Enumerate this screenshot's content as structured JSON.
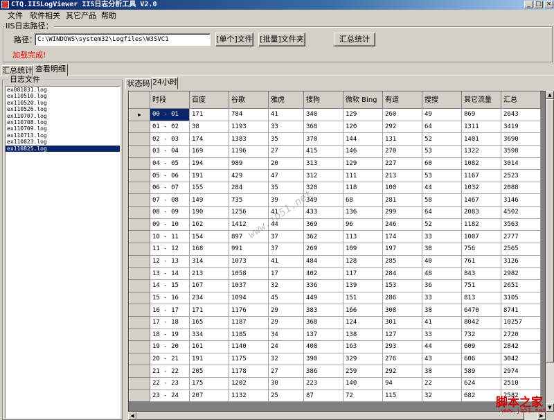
{
  "window": {
    "title": "CTQ.IISLogViewer IIS日志分析工具 V2.0",
    "minimize": "_",
    "maximize": "□",
    "close": "×"
  },
  "menu": [
    "文件",
    "软件相关",
    "其它产品",
    "帮助"
  ],
  "path_group": {
    "label": "IIS日志路径：",
    "path_label": "路径：",
    "path_value": "C:\\WINDOWS\\system32\\Logfiles\\W3SVC1",
    "single_button": "[单个]文件",
    "batch_button": "[批量]文件夹",
    "summary_button": "汇总统计",
    "status": "加载完成!"
  },
  "main_tabs": [
    "汇总统计",
    "查看明细"
  ],
  "log_files": {
    "label": "日志文件",
    "items": [
      "ex081031.log",
      "ex110510.log",
      "ex110520.log",
      "ex110526.log",
      "ex110707.log",
      "ex110708.log",
      "ex110709.log",
      "ex110713.log",
      "ex110823.log",
      "ex110825.log"
    ],
    "selected_index": 9
  },
  "sub_tabs": [
    "状态码",
    "24小时"
  ],
  "table": {
    "columns": [
      "时段",
      "百度",
      "谷歌",
      "雅虎",
      "搜狗",
      "微软 Bing",
      "有道",
      "搜搜",
      "其它流量",
      "汇总"
    ],
    "rows": [
      [
        "00 - 01",
        "171",
        "784",
        "41",
        "340",
        "129",
        "260",
        "49",
        "869",
        "2643"
      ],
      [
        "01 - 02",
        "38",
        "1193",
        "33",
        "368",
        "120",
        "292",
        "64",
        "1311",
        "3419"
      ],
      [
        "02 - 03",
        "174",
        "1383",
        "35",
        "370",
        "144",
        "131",
        "52",
        "1401",
        "3690"
      ],
      [
        "03 - 04",
        "169",
        "1196",
        "27",
        "415",
        "146",
        "270",
        "53",
        "1322",
        "3598"
      ],
      [
        "04 - 05",
        "194",
        "989",
        "20",
        "313",
        "129",
        "227",
        "60",
        "1082",
        "3014"
      ],
      [
        "05 - 06",
        "191",
        "429",
        "47",
        "312",
        "111",
        "213",
        "53",
        "1167",
        "2523"
      ],
      [
        "06 - 07",
        "155",
        "284",
        "35",
        "320",
        "118",
        "100",
        "44",
        "1032",
        "2088"
      ],
      [
        "07 - 08",
        "149",
        "735",
        "39",
        "349",
        "68",
        "281",
        "58",
        "1467",
        "3146"
      ],
      [
        "08 - 09",
        "190",
        "1256",
        "41",
        "433",
        "136",
        "299",
        "64",
        "2083",
        "4502"
      ],
      [
        "09 - 10",
        "162",
        "1412",
        "44",
        "369",
        "96",
        "246",
        "52",
        "1182",
        "3563"
      ],
      [
        "10 - 11",
        "154",
        "897",
        "37",
        "362",
        "113",
        "174",
        "33",
        "1007",
        "2777"
      ],
      [
        "11 - 12",
        "168",
        "991",
        "37",
        "269",
        "109",
        "197",
        "38",
        "756",
        "2565"
      ],
      [
        "12 - 13",
        "314",
        "1073",
        "41",
        "484",
        "128",
        "285",
        "40",
        "761",
        "3126"
      ],
      [
        "13 - 14",
        "213",
        "1058",
        "17",
        "402",
        "117",
        "284",
        "48",
        "843",
        "2982"
      ],
      [
        "14 - 15",
        "167",
        "1037",
        "32",
        "336",
        "139",
        "153",
        "36",
        "751",
        "2651"
      ],
      [
        "15 - 16",
        "234",
        "1094",
        "45",
        "449",
        "151",
        "286",
        "33",
        "813",
        "3105"
      ],
      [
        "16 - 17",
        "171",
        "1176",
        "29",
        "383",
        "166",
        "308",
        "38",
        "6470",
        "8741"
      ],
      [
        "17 - 18",
        "165",
        "1187",
        "29",
        "368",
        "124",
        "301",
        "41",
        "8042",
        "10257"
      ],
      [
        "18 - 19",
        "334",
        "1185",
        "34",
        "137",
        "138",
        "127",
        "33",
        "732",
        "2720"
      ],
      [
        "19 - 20",
        "161",
        "1140",
        "24",
        "408",
        "163",
        "293",
        "44",
        "609",
        "2842"
      ],
      [
        "20 - 21",
        "191",
        "1175",
        "32",
        "390",
        "329",
        "276",
        "43",
        "606",
        "3042"
      ],
      [
        "21 - 22",
        "205",
        "1178",
        "27",
        "386",
        "259",
        "292",
        "38",
        "589",
        "2974"
      ],
      [
        "22 - 23",
        "175",
        "1202",
        "30",
        "223",
        "140",
        "94",
        "22",
        "624",
        "2510"
      ],
      [
        "23 - 24",
        "207",
        "1132",
        "25",
        "87",
        "72",
        "115",
        "32",
        "682",
        "2582"
      ]
    ]
  },
  "watermark": "www.jb51.net",
  "logo": {
    "text": "脚本之家",
    "url": "www.jb51.net"
  }
}
